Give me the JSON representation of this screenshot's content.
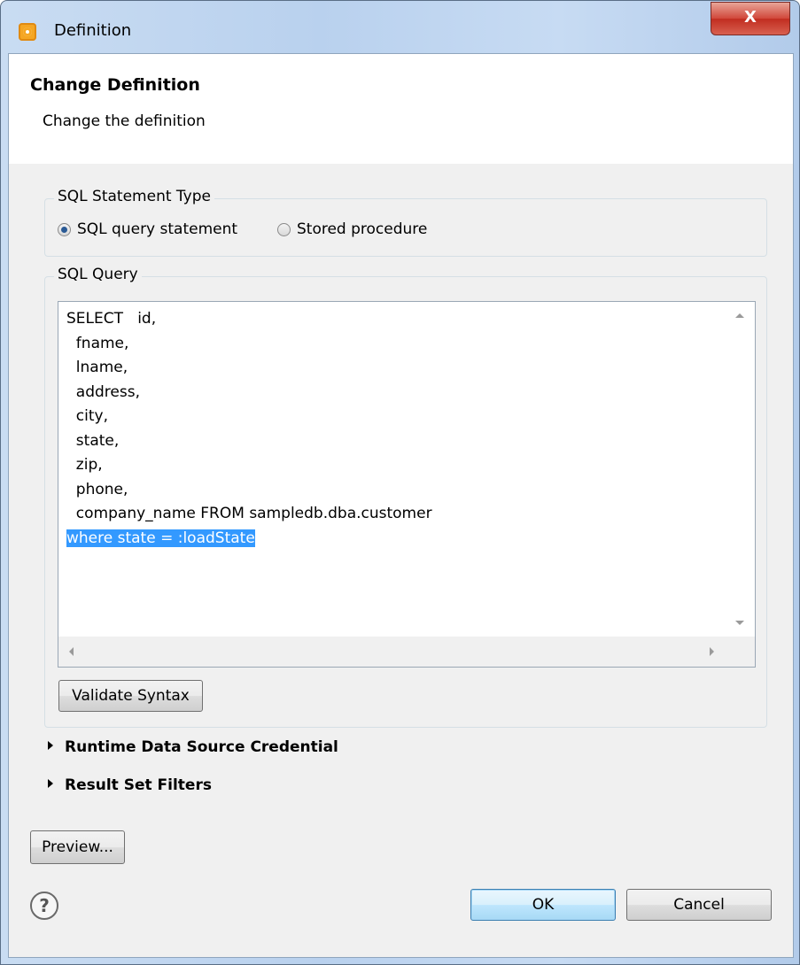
{
  "window": {
    "title": "Definition",
    "close_glyph": "X"
  },
  "banner": {
    "title": "Change Definition",
    "description": "Change the definition"
  },
  "statement_type": {
    "legend": "SQL Statement Type",
    "options": [
      {
        "label": "SQL query statement",
        "checked": true
      },
      {
        "label": "Stored procedure",
        "checked": false
      }
    ]
  },
  "sql_query": {
    "legend": "SQL Query",
    "lines": [
      "SELECT   id,",
      "  fname,",
      "  lname,",
      "  address,",
      "  city,",
      "  state,",
      "  zip,",
      "  phone,",
      "  company_name FROM sampledb.dba.customer",
      "where state = :loadState"
    ],
    "selected_line_index": 9,
    "validate_label": "Validate Syntax"
  },
  "sections": {
    "runtime_credential": "Runtime Data Source Credential",
    "result_set_filters": "Result Set Filters"
  },
  "buttons": {
    "preview": "Preview...",
    "ok": "OK",
    "cancel": "Cancel",
    "help_glyph": "?"
  },
  "colors": {
    "selection": "#3399ff",
    "close_button": "#c12d20"
  }
}
